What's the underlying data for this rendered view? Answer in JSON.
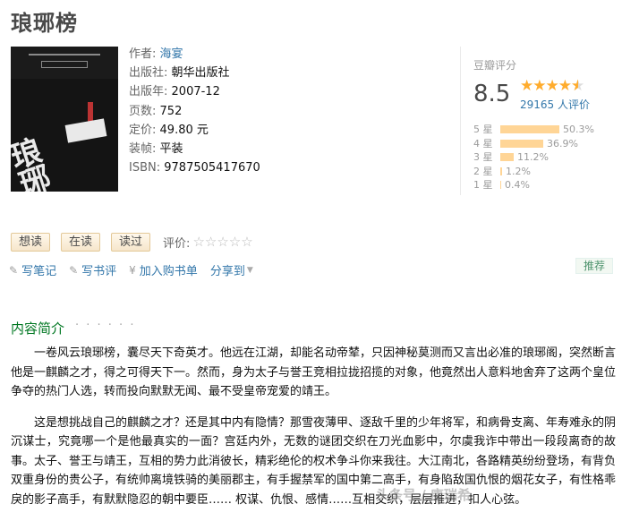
{
  "book": {
    "title": "琅琊榜",
    "cover": {
      "top_text": "国内外华语名著",
      "side_text": "琅琊榜",
      "stamp_text": "琅琊山海"
    },
    "meta": [
      {
        "label": "作者:",
        "value": "海宴",
        "link": true
      },
      {
        "label": "出版社:",
        "value": "朝华出版社",
        "link": false
      },
      {
        "label": "出版年:",
        "value": "2007-12",
        "link": false
      },
      {
        "label": "页数:",
        "value": "752",
        "link": false
      },
      {
        "label": "定价:",
        "value": "49.80 元",
        "link": false
      },
      {
        "label": "装帧:",
        "value": "平装",
        "link": false
      },
      {
        "label": "ISBN:",
        "value": "9787505417670",
        "link": false
      }
    ]
  },
  "rating": {
    "label": "豆瓣评分",
    "score": "8.5",
    "stars_value": 4.5,
    "count_text": "29165 人评价",
    "distribution": [
      {
        "label": "5 星",
        "percent": 50.3,
        "text": "50.3%"
      },
      {
        "label": "4 星",
        "percent": 36.9,
        "text": "36.9%"
      },
      {
        "label": "3 星",
        "percent": 11.2,
        "text": "11.2%"
      },
      {
        "label": "2 星",
        "percent": 1.2,
        "text": "1.2%"
      },
      {
        "label": "1 星",
        "percent": 0.4,
        "text": "0.4%"
      }
    ]
  },
  "actions": {
    "want": "想读",
    "reading": "在读",
    "read": "读过",
    "rate_label": "评价:",
    "empty_stars": "☆☆☆☆☆"
  },
  "links": {
    "note": "写笔记",
    "review": "写书评",
    "cart": "加入购书单",
    "share": "分享到"
  },
  "recommend": "推荐",
  "intro": {
    "title": "内容简介",
    "dots": "· · · · · ·",
    "paragraphs": [
      "一卷风云琅琊榜，囊尽天下奇英才。他远在江湖，却能名动帝辇，只因神秘莫测而又言出必准的琅琊阁，突然断言他是一麒麟之才，得之可得天下一。然而，身为太子与誉王竞相拉拢招揽的对象，他竟然出人意料地舍弃了这两个皇位争夺的热门人选，转而投向默默无闻、最不受皇帝宠爱的靖王。",
      "这是想挑战自己的麒麟之才？还是其中内有隐情？那雪夜薄甲、逐敌千里的少年将军，和病骨支离、年寿难永的阴沉谋士，究竟哪一个是他最真实的一面？宫廷内外，无数的谜团交织在刀光血影中，尔虞我诈中带出一段段离奇的故事。太子、誉王与靖王，互相的势力此消彼长，精彩绝伦的权术争斗你来我往。大江南北，各路精英纷纷登场，有背负双重身份的贵公子，有统帅离境铁骑的美丽郡主，有手握禁军的国中第二高手，有身陷敌国仇恨的烟花女子，有性格乖戾的影子高手，有默默隐忍的朝中要臣…… 权谋、仇恨、感情……互相交织，层层推进，扣人心弦。"
    ]
  },
  "watermark": "头条号 / 康瑞希"
}
